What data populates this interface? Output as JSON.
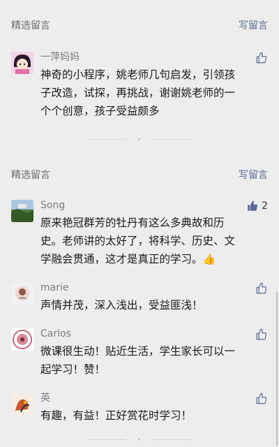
{
  "section1": {
    "title": "精选留言",
    "write": "写留言",
    "comments": [
      {
        "nickname": "一萍妈妈",
        "text": "神奇的小程序，姚老师几句启发，引领孩子改造，试探，再挑战，谢谢姚老师的一个个创意，孩子受益颇多",
        "likes": ""
      }
    ]
  },
  "section2": {
    "title": "精选留言",
    "write": "写留言",
    "comments": [
      {
        "nickname": "Song",
        "text": "原来艳冠群芳的牡丹有这么多典故和历史。老师讲的太好了，将科学、历史、文学融会贯通，这才是真正的学习。",
        "emoji": "👍",
        "likes": "2"
      },
      {
        "nickname": "marie",
        "text": "声情并茂，深入浅出，受益匪浅！",
        "likes": ""
      },
      {
        "nickname": "Carlos",
        "text": "微课很生动！贴近生活，学生家长可以一起学习！赞！",
        "likes": ""
      },
      {
        "nickname": "英",
        "text": "有趣，有益！正好赏花时学习！",
        "likes": ""
      }
    ]
  },
  "colors": {
    "background": "#ededed",
    "link": "#576b95",
    "nickname": "#7c7c7c",
    "text": "#1a1a1a"
  }
}
